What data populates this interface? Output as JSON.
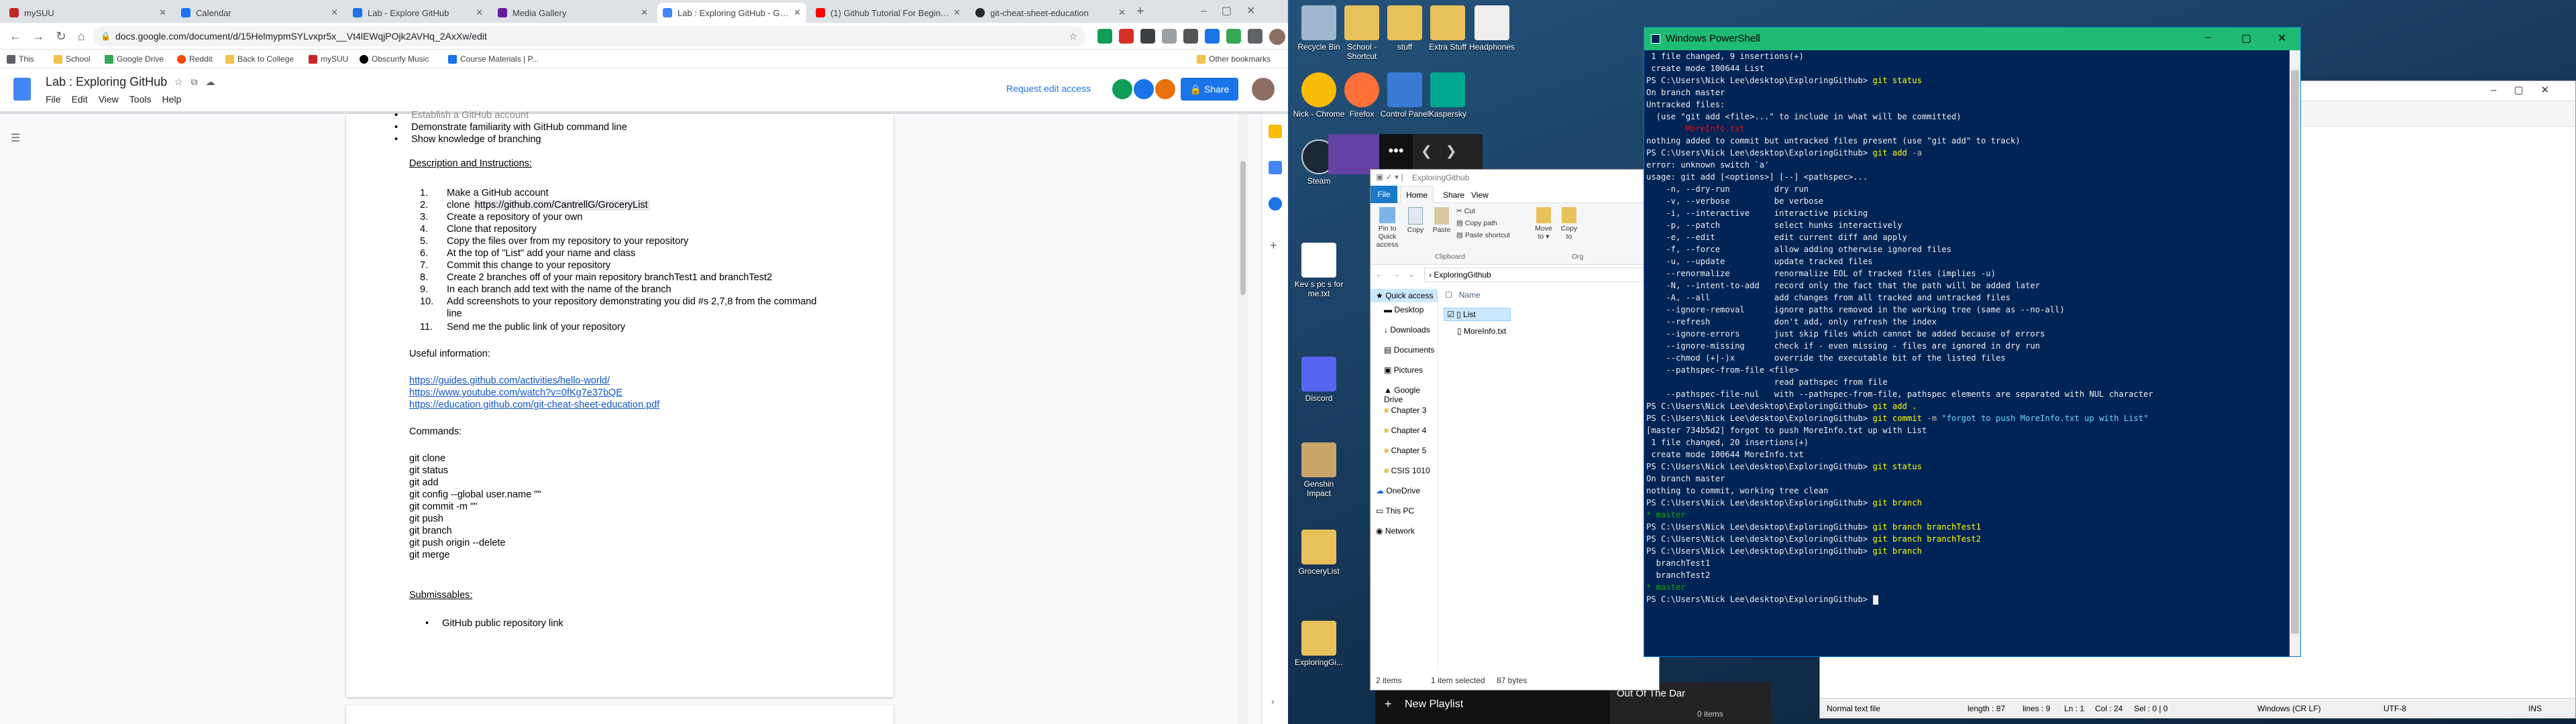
{
  "browser": {
    "tabs": [
      {
        "label": "mySUU",
        "color": "#c62828"
      },
      {
        "label": "Calendar",
        "color": "#1a73e8"
      },
      {
        "label": "Lab - Explore GitHub",
        "color": "#1a73e8"
      },
      {
        "label": "Media Gallery",
        "color": "#6a1b9a"
      },
      {
        "label": "Lab : Exploring GitHub - Google",
        "color": "#4285f4"
      },
      {
        "label": "(1) Github Tutorial For Beginner",
        "color": "#ff0000"
      },
      {
        "label": "git-cheat-sheet-education",
        "color": "#24292e"
      }
    ],
    "url": "docs.google.com/document/d/15HelmypmSYLvxpr5x__Vt4lEWqjPOjk2AVHq_2AxXw/edit",
    "bookmarks": [
      "This",
      "School",
      "Google Drive",
      "Reddit",
      "Back to College",
      "mySUU",
      "Obscurify Music",
      "Course Materials | P..."
    ],
    "other_bookmarks": "Other bookmarks"
  },
  "docs": {
    "title": "Lab : Exploring GitHub",
    "menu": [
      "File",
      "Edit",
      "View",
      "Tools",
      "Help"
    ],
    "request_edit": "Request edit access",
    "share": "Share",
    "content": {
      "b1": "Demonstrate familiarity with GitHub command line",
      "b2": "Show knowledge of branching",
      "desc_heading": "Description and Instructions:",
      "steps": [
        "Make a GitHub account",
        "clone",
        "Create a repository of your own",
        "Clone that repository",
        "Copy the files over from my repository to your repository",
        "At the top of \"List\" add your name and class",
        "Commit this change to your repository",
        "Create 2 branches off of your main repository branchTest1 and branchTest2",
        "In each branch add text with the name of the branch",
        "Add screenshots to your repository demonstrating you did #s 2,7,8 from the command",
        "Send me the public link of your repository"
      ],
      "step2_link": "https://github.com/CantrellG/GroceryList",
      "step10_cont": "line",
      "useful": "Useful information:",
      "links": [
        "https://guides.github.com/activities/hello-world/",
        "https://www.youtube.com/watch?v=0fKg7e37bQE",
        "https://education.github.com/git-cheat-sheet-education.pdf"
      ],
      "commands_heading": "Commands:",
      "commands": [
        "git clone",
        "git status",
        "git add",
        "git config --global user.name \"\"",
        "git commit -m \"\"",
        "git push",
        "git branch",
        "git push origin --delete",
        "git merge"
      ],
      "submissables": "Submissables:",
      "sub_item": "GitHub public repository link"
    }
  },
  "desktop": {
    "icons": [
      {
        "label": "Recycle Bin",
        "color": "#9fb8d0"
      },
      {
        "label": "School - Shortcut",
        "color": "#e8c15a"
      },
      {
        "label": "stuff",
        "color": "#e8c15a"
      },
      {
        "label": "Extra Stuff",
        "color": "#e8c15a"
      },
      {
        "label": "Headphones",
        "color": "#eeeeee"
      },
      {
        "label": "Nick - Chrome",
        "color": "#fbbc05"
      },
      {
        "label": "Firefox",
        "color": "#ff7139"
      },
      {
        "label": "Control Panel",
        "color": "#3a7bd5"
      },
      {
        "label": "Kaspersky",
        "color": "#00a88e"
      },
      {
        "label": "Steam",
        "color": "#1b2838"
      },
      {
        "label": "Kev s pc s for me.txt",
        "color": "#ffffff"
      },
      {
        "label": "Discord",
        "color": "#5865f2"
      },
      {
        "label": "Genshin Impact",
        "color": "#c9a56a"
      },
      {
        "label": "GroceryList",
        "color": "#e8c15a"
      },
      {
        "label": "ExploringGi...",
        "color": "#e8c15a"
      }
    ],
    "music": {
      "new_playlist": "New Playlist",
      "track": "Out Of The Dar"
    }
  },
  "explorer": {
    "title": "ExploringGithub",
    "tabs": [
      "File",
      "Home",
      "Share",
      "View"
    ],
    "ribbon": {
      "pin": "Pin to Quick access",
      "copy": "Copy",
      "paste": "Paste",
      "cut": "Cut",
      "copy_path": "Copy path",
      "paste_shortcut": "Paste shortcut",
      "clipboard": "Clipboard",
      "move_to": "Move to",
      "copy_to": "Copy to",
      "org": "Org"
    },
    "path": "ExploringGithub",
    "nav": [
      "Quick access",
      "Desktop",
      "Downloads",
      "Documents",
      "Pictures",
      "Google Drive",
      "Chapter 3",
      "Chapter 4",
      "Chapter 5",
      "CSIS 1010",
      "OneDrive",
      "This PC",
      "Network"
    ],
    "col_name": "Name",
    "files": [
      "List",
      "MoreInfo.txt"
    ],
    "status": {
      "count": "2 items",
      "selected": "1 item selected",
      "size": "87 bytes"
    },
    "extra_count": "0 items"
  },
  "notepad": {
    "status": {
      "type": "Normal text file",
      "length": "length : 87",
      "lines": "lines : 9",
      "ln": "Ln : 1",
      "col": "Col : 24",
      "sel": "Sel : 0 | 0",
      "eol": "Windows (CR LF)",
      "enc": "UTF-8",
      "ins": "INS"
    }
  },
  "powershell": {
    "title": "Windows PowerShell",
    "lines": [
      {
        "t": " 1 file changed, 9 insertions(+)"
      },
      {
        "t": " create mode 100644 List"
      },
      {
        "t": "PS C:\\Users\\Nick Lee\\desktop\\ExploringGithub> ",
        "cmd": "git status"
      },
      {
        "t": "On branch master"
      },
      {
        "t": "Untracked files:"
      },
      {
        "t": "  (use \"git add <file>...\" to include in what will be committed)"
      },
      {
        "t": ""
      },
      {
        "t": "        MoreInfo.txt",
        "cls": "r"
      },
      {
        "t": ""
      },
      {
        "t": "nothing added to commit but untracked files present (use \"git add\" to track)"
      },
      {
        "t": "PS C:\\Users\\Nick Lee\\desktop\\ExploringGithub> ",
        "cmd": "git add ",
        "arg": "-a"
      },
      {
        "t": "error: unknown switch `a'"
      },
      {
        "t": "usage: git add [<options>] [--] <pathspec>..."
      },
      {
        "t": ""
      },
      {
        "t": "    -n, --dry-run         dry run"
      },
      {
        "t": "    -v, --verbose         be verbose"
      },
      {
        "t": ""
      },
      {
        "t": "    -i, --interactive     interactive picking"
      },
      {
        "t": "    -p, --patch           select hunks interactively"
      },
      {
        "t": "    -e, --edit            edit current diff and apply"
      },
      {
        "t": "    -f, --force           allow adding otherwise ignored files"
      },
      {
        "t": "    -u, --update          update tracked files"
      },
      {
        "t": "    --renormalize         renormalize EOL of tracked files (implies -u)"
      },
      {
        "t": "    -N, --intent-to-add   record only the fact that the path will be added later"
      },
      {
        "t": "    -A, --all             add changes from all tracked and untracked files"
      },
      {
        "t": "    --ignore-removal      ignore paths removed in the working tree (same as --no-all)"
      },
      {
        "t": "    --refresh             don't add, only refresh the index"
      },
      {
        "t": "    --ignore-errors       just skip files which cannot be added because of errors"
      },
      {
        "t": "    --ignore-missing      check if - even missing - files are ignored in dry run"
      },
      {
        "t": "    --chmod (+|-)x        override the executable bit of the listed files"
      },
      {
        "t": "    --pathspec-from-file <file>"
      },
      {
        "t": "                          read pathspec from file"
      },
      {
        "t": "    --pathspec-file-nul   with --pathspec-from-file, pathspec elements are separated with NUL character"
      },
      {
        "t": ""
      },
      {
        "t": "PS C:\\Users\\Nick Lee\\desktop\\ExploringGithub> ",
        "cmd": "git add ."
      },
      {
        "t": "PS C:\\Users\\Nick Lee\\desktop\\ExploringGithub> ",
        "cmd": "git commit ",
        "arg": "-m",
        "str": " \"forgot to push MoreInfo.txt up with List\""
      },
      {
        "t": "[master 734b5d2] forgot to push MoreInfo.txt up with List"
      },
      {
        "t": " 1 file changed, 20 insertions(+)"
      },
      {
        "t": " create mode 100644 MoreInfo.txt"
      },
      {
        "t": "PS C:\\Users\\Nick Lee\\desktop\\ExploringGithub> ",
        "cmd": "git status"
      },
      {
        "t": "On branch master"
      },
      {
        "t": "nothing to commit, working tree clean"
      },
      {
        "t": "PS C:\\Users\\Nick Lee\\desktop\\ExploringGithub> ",
        "cmd": "git branch"
      },
      {
        "t": "* master",
        "cls": "gr"
      },
      {
        "t": "PS C:\\Users\\Nick Lee\\desktop\\ExploringGithub> ",
        "cmd": "git branch branchTest1"
      },
      {
        "t": "PS C:\\Users\\Nick Lee\\desktop\\ExploringGithub> ",
        "cmd": "git branch branchTest2"
      },
      {
        "t": "PS C:\\Users\\Nick Lee\\desktop\\ExploringGithub> ",
        "cmd": "git branch"
      },
      {
        "t": "  branchTest1"
      },
      {
        "t": "  branchTest2"
      },
      {
        "t": "* master",
        "cls": "gr"
      },
      {
        "t": "PS C:\\Users\\Nick Lee\\desktop\\ExploringGithub> "
      }
    ]
  }
}
